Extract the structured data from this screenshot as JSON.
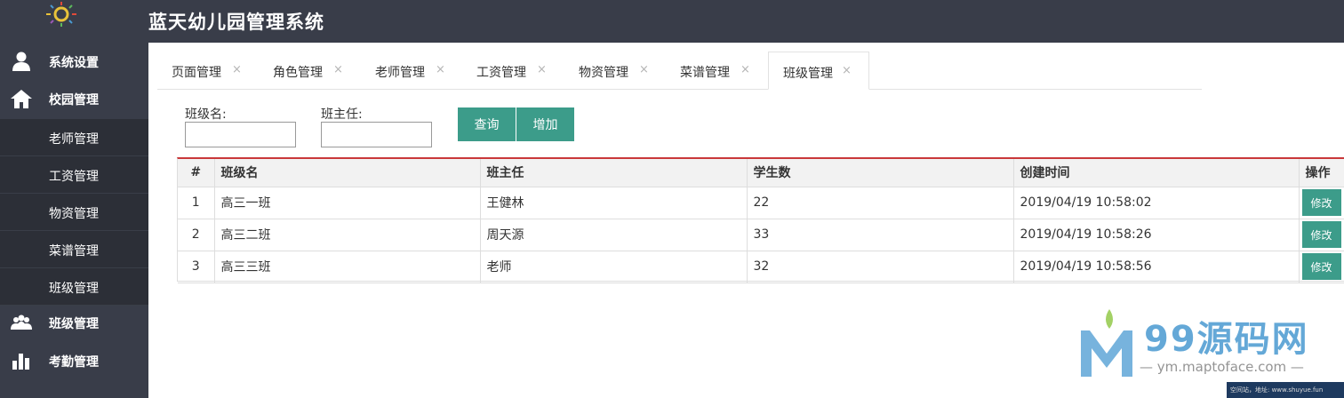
{
  "app": {
    "title": "蓝天幼儿园管理系统"
  },
  "sidebar": {
    "groups": [
      {
        "label": "系统设置",
        "icon": "user-icon"
      },
      {
        "label": "校园管理",
        "icon": "home-icon"
      },
      {
        "label": "班级管理",
        "icon": "group-icon"
      },
      {
        "label": "考勤管理",
        "icon": "bar-chart-icon"
      }
    ],
    "sub_items": [
      "老师管理",
      "工资管理",
      "物资管理",
      "菜谱管理",
      "班级管理"
    ]
  },
  "tabs": [
    {
      "label": "页面管理",
      "close": "×"
    },
    {
      "label": "角色管理",
      "close": "×"
    },
    {
      "label": "老师管理",
      "close": "×"
    },
    {
      "label": "工资管理",
      "close": "×"
    },
    {
      "label": "物资管理",
      "close": "×"
    },
    {
      "label": "菜谱管理",
      "close": "×"
    },
    {
      "label": "班级管理",
      "close": "×",
      "active": true
    }
  ],
  "search": {
    "class_name_label": "班级名:",
    "class_name_value": "",
    "teacher_label": "班主任:",
    "teacher_value": "",
    "query_label": "查询",
    "add_label": "增加"
  },
  "table": {
    "headers": [
      "#",
      "班级名",
      "班主任",
      "学生数",
      "创建时间",
      "操作"
    ],
    "rows": [
      {
        "index": "1",
        "class_name": "高三一班",
        "teacher": "王健林",
        "students": "22",
        "created": "2019/04/19 10:58:02",
        "action": "修改"
      },
      {
        "index": "2",
        "class_name": "高三二班",
        "teacher": "周天源",
        "students": "33",
        "created": "2019/04/19 10:58:26",
        "action": "修改"
      },
      {
        "index": "3",
        "class_name": "高三三班",
        "teacher": "老师",
        "students": "32",
        "created": "2019/04/19 10:58:56",
        "action": "修改"
      }
    ]
  },
  "watermark": {
    "title": "99源码网",
    "url": "— ym.maptoface.com —",
    "strip": "空间站，地址: www.shuyue.fun"
  },
  "colors": {
    "header_bg": "#393d49",
    "sidebar_bg": "#393d49",
    "submenu_bg": "#2c2f37",
    "accent": "#3c9c8a",
    "table_top_border": "#c9383a"
  }
}
